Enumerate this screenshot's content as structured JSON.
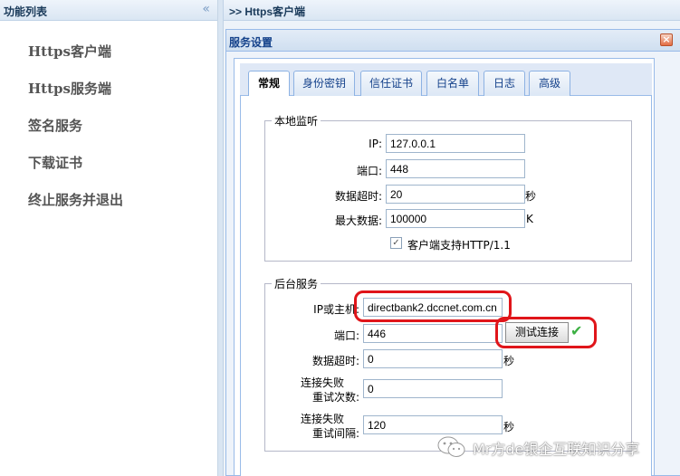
{
  "left_panel": {
    "title": "功能列表",
    "collapse_glyph": "«",
    "menu": [
      "Https客户端",
      "Https服务端",
      "签名服务",
      "下载证书",
      "终止服务并退出"
    ]
  },
  "breadcrumb": ">> Https客户端",
  "dialog": {
    "title": "服务设置",
    "close_glyph": "×",
    "tabs": [
      "常规",
      "身份密钥",
      "信任证书",
      "白名单",
      "日志",
      "高级"
    ],
    "active_tab": "常规",
    "local_listen": {
      "legend": "本地监听",
      "ip_label": "IP:",
      "ip_value": "127.0.0.1",
      "port_label": "端口:",
      "port_value": "448",
      "timeout_label": "数据超时:",
      "timeout_value": "20",
      "timeout_unit": "秒",
      "maxdata_label": "最大数据:",
      "maxdata_value": "100000",
      "maxdata_unit": "K",
      "http11_checked": true,
      "http11_label": "客户端支持HTTP/1.1"
    },
    "backend": {
      "legend": "后台服务",
      "host_label": "IP或主机:",
      "host_value": "directbank2.dccnet.com.cn",
      "port_label": "端口:",
      "port_value": "446",
      "test_button": "测试连接",
      "timeout_label": "数据超时:",
      "timeout_value": "0",
      "timeout_unit": "秒",
      "retry_label_1": "连接失败",
      "retry_label_2": "重试次数:",
      "retry_value": "0",
      "interval_label_1": "连接失败",
      "interval_label_2": "重试间隔:",
      "interval_value": "120",
      "interval_unit": "秒"
    }
  },
  "watermark": "Mr方de银企互联知识分享",
  "colors": {
    "accent_border": "#99bbe8",
    "highlight_red": "#e0151a",
    "check_green": "#3cb043"
  }
}
